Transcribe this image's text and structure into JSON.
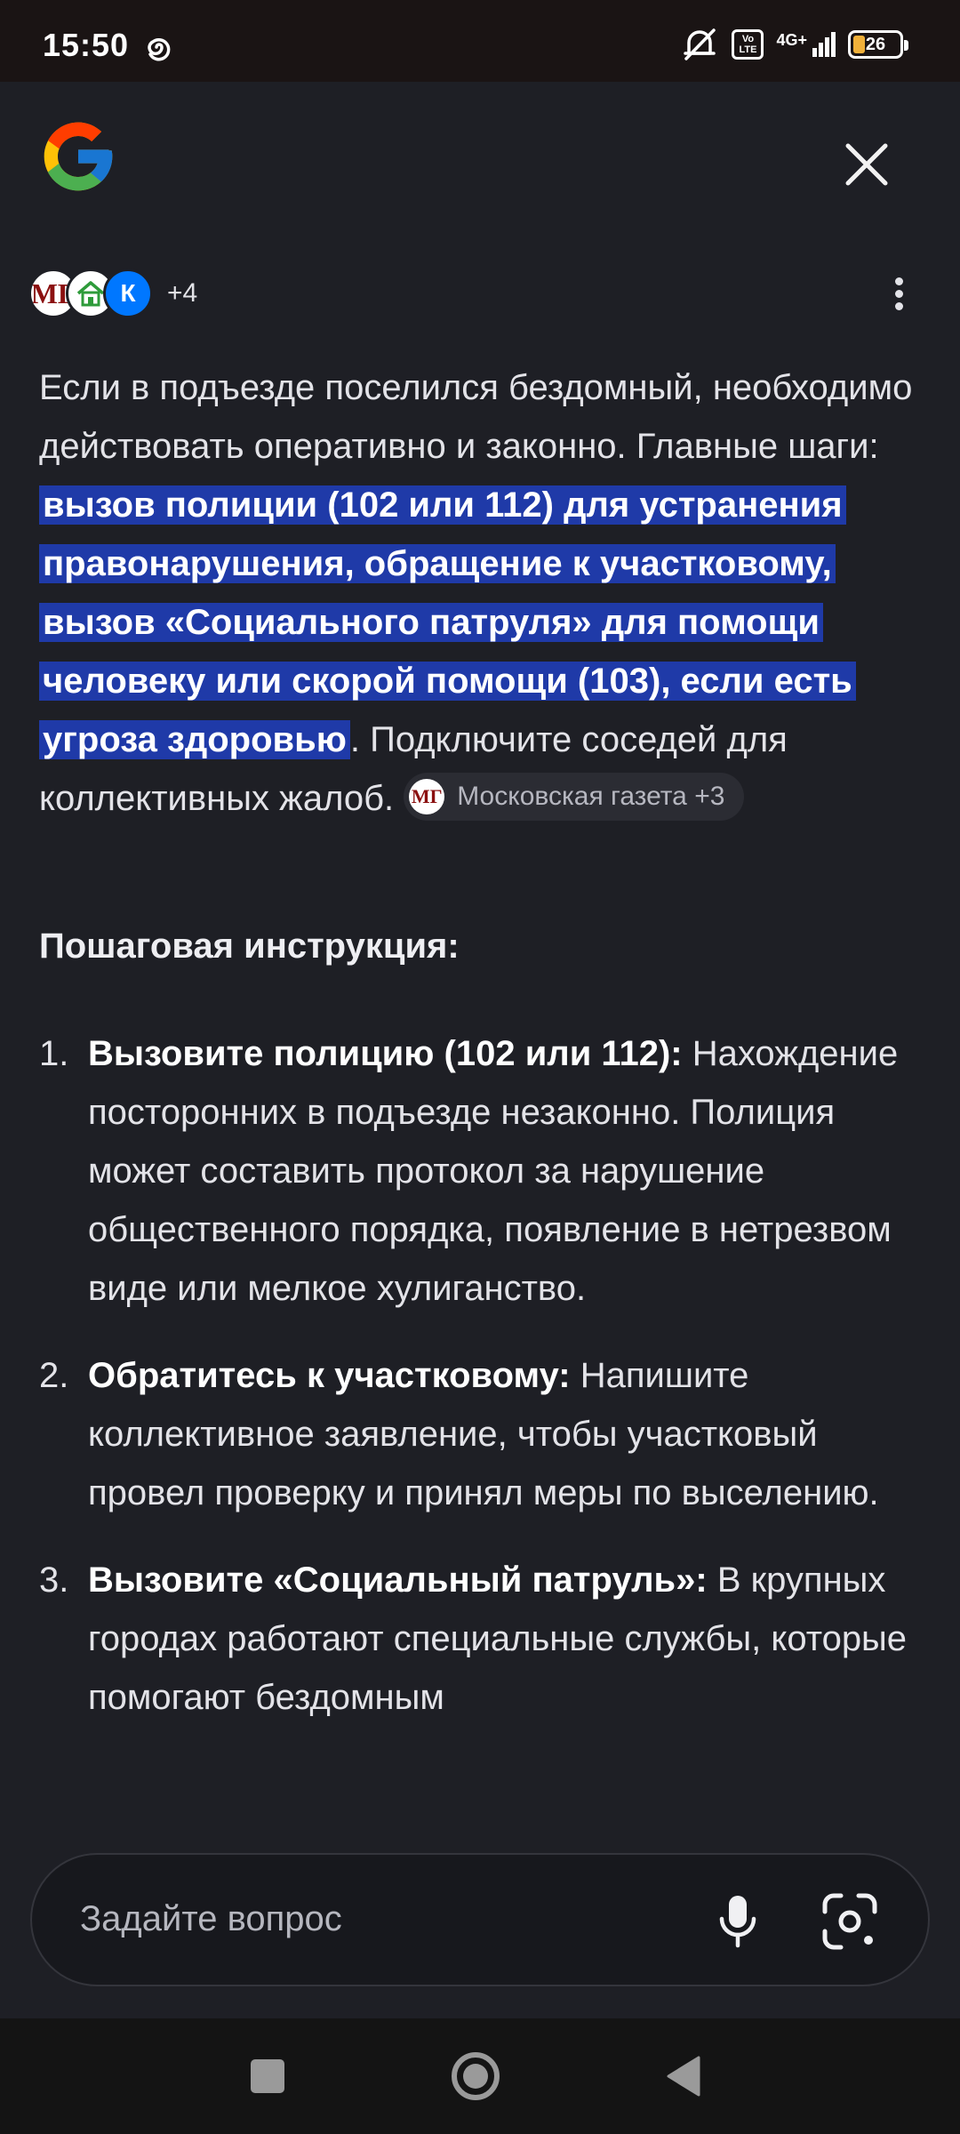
{
  "status_bar": {
    "time": "15:50",
    "network": "4G+",
    "volte": "Vo LTE",
    "battery": "26",
    "battery_level": 0.26,
    "icons": [
      "swirl-icon",
      "mute-icon",
      "volte-icon",
      "signal-icon",
      "battery-icon"
    ]
  },
  "header": {
    "logo_icon": "google-g-icon",
    "close_icon": "close-icon"
  },
  "sources": {
    "avatars": [
      {
        "label": "МГ"
      },
      {
        "label": "home"
      },
      {
        "label": "К"
      }
    ],
    "more_count": "+4",
    "menu_icon": "more-vert-icon"
  },
  "answer": {
    "intro": "Если в подъезде поселился бездомный, необходимо действовать оперативно и законно. Главные шаги: ",
    "highlighted": "вызов полиции (102 или 112) для устранения правонарушения, обращение к участковому, вызов «Социального патруля» для помощи человеку или скорой помощи (103), если есть угроза здоровью",
    "outro": ". Подключите соседей для коллективных жалоб. ",
    "chip": {
      "avatar": "МГ",
      "label": "Московская газета +3"
    },
    "highlight_color": "#1f3aa8"
  },
  "steps_heading": "Пошаговая инструкция:",
  "steps": [
    {
      "num": "1.",
      "title": "Вызовите полицию (102 или 112):",
      "text": " Нахождение посторонних в подъезде незаконно. Полиция может составить протокол за нарушение общественного порядка, появление в нетрезвом виде или мелкое хулиганство."
    },
    {
      "num": "2.",
      "title": "Обратитесь к участковому:",
      "text": " Напишите коллективное заявление, чтобы участковый провел проверку и принял меры по выселению."
    },
    {
      "num": "3.",
      "title": "Вызовите «Социальный патруль»:",
      "text": " В крупных городах работают специальные службы, которые помогают бездомным"
    }
  ],
  "ask_bar": {
    "placeholder": "Задайте вопрос",
    "mic_icon": "mic-icon",
    "lens_icon": "google-lens-icon"
  },
  "nav_bar": {
    "icons": [
      "recents-icon",
      "home-icon",
      "back-icon"
    ]
  }
}
